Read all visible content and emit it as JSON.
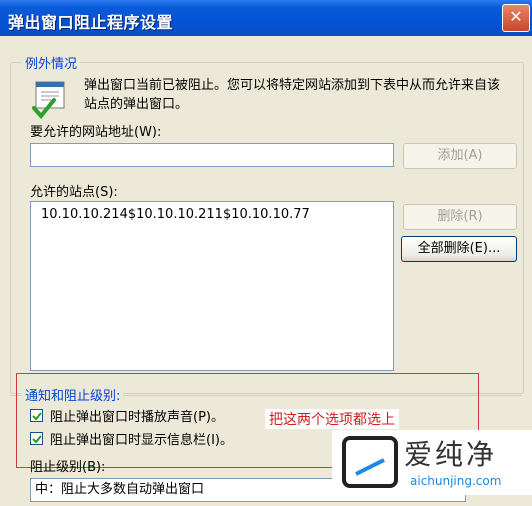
{
  "window": {
    "title": "弹出窗口阻止程序设置",
    "close_glyph": "✕"
  },
  "exceptions": {
    "legend": "例外情况",
    "description": "弹出窗口当前已被阻止。您可以将特定网站添加到下表中从而允许来自该站点的弹出窗口。",
    "address_label": "要允许的网站地址(W):",
    "address_value": "",
    "add_button": "添加(A)",
    "allowed_label": "允许的站点(S):",
    "allowed_sites": [
      "10.10.10.214$10.10.10.211$10.10.10.77"
    ],
    "remove_button": "删除(R)",
    "remove_all_button": "全部删除(E)..."
  },
  "notification": {
    "legend": "通知和阻止级别:",
    "play_sound": {
      "label": "阻止弹出窗口时播放声音(P)。",
      "checked": true
    },
    "show_bar": {
      "label": "阻止弹出窗口时显示信息栏(I)。",
      "checked": true
    },
    "annotation": "把这两个选项都选上",
    "level_label": "阻止级别(B):",
    "level_value": "中：阻止大多数自动弹出窗口"
  },
  "watermark": {
    "brand": "爱纯净",
    "url": "aichunjing.com"
  },
  "colors": {
    "title_bar": "#0352D6",
    "legend_text": "#0046D5",
    "annotation": "#D21D1D"
  }
}
